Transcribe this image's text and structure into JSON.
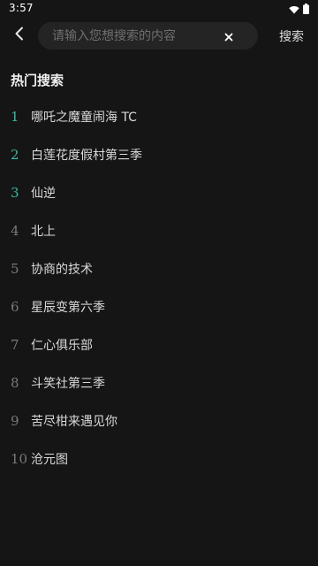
{
  "status_bar": {
    "time": "3:57",
    "icons": [
      "wifi-icon",
      "battery-icon"
    ]
  },
  "search": {
    "placeholder": "请输入您想搜索的内容",
    "value": "",
    "submit_label": "搜索"
  },
  "hot_section": {
    "title": "热门搜索",
    "items": [
      {
        "rank": "1",
        "text": "哪吒之魔童闹海 TC"
      },
      {
        "rank": "2",
        "text": "白莲花度假村第三季"
      },
      {
        "rank": "3",
        "text": "仙逆"
      },
      {
        "rank": "4",
        "text": "北上"
      },
      {
        "rank": "5",
        "text": "协商的技术"
      },
      {
        "rank": "6",
        "text": "星辰变第六季"
      },
      {
        "rank": "7",
        "text": "仁心俱乐部"
      },
      {
        "rank": "8",
        "text": "斗笑社第三季"
      },
      {
        "rank": "9",
        "text": "苦尽柑来遇见你"
      },
      {
        "rank": "10",
        "text": "沧元图"
      }
    ]
  },
  "colors": {
    "background": "#151515",
    "search_box": "#242424",
    "rank_highlight": "#3bb8a4",
    "rank_normal": "#7a7a7a"
  }
}
